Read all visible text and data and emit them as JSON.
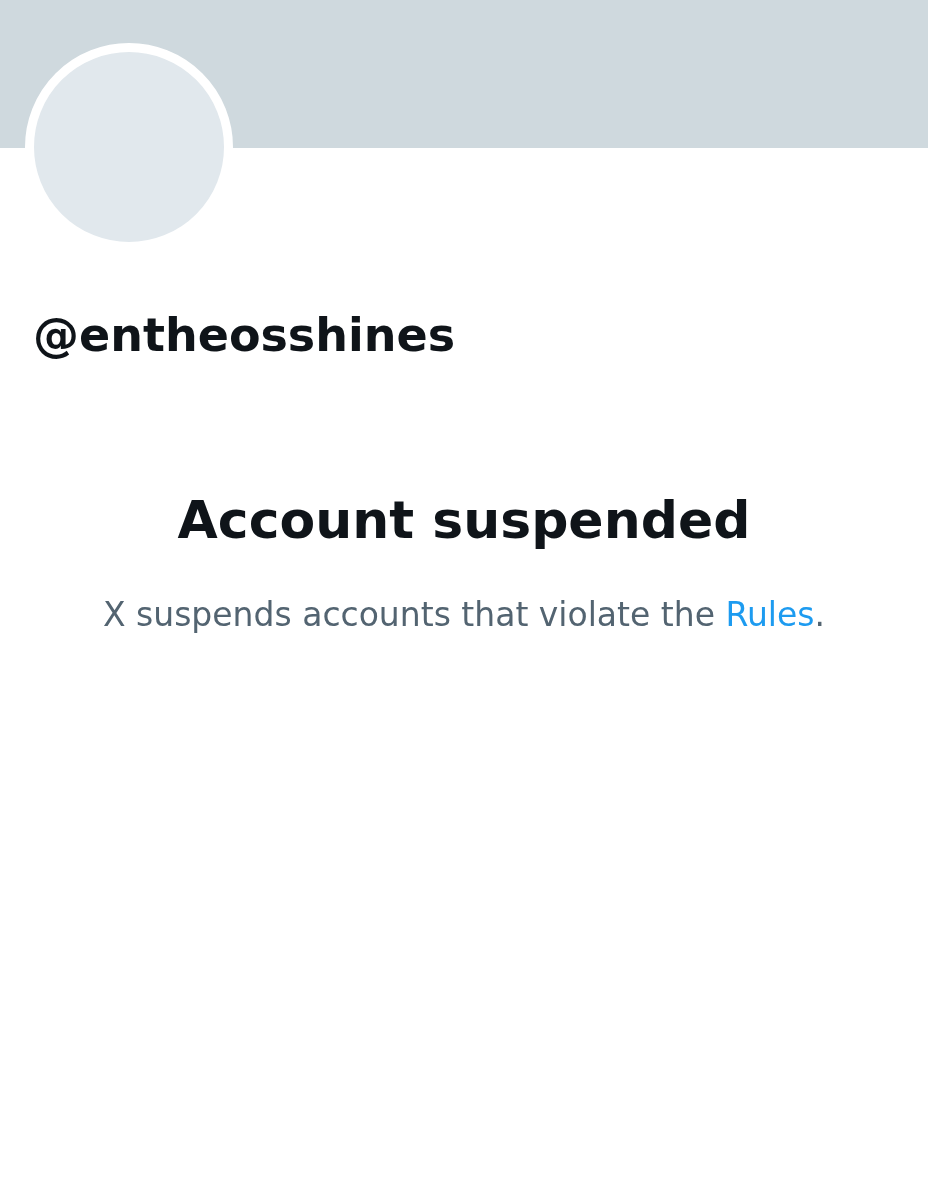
{
  "profile": {
    "handle": "@entheosshines"
  },
  "notice": {
    "title": "Account suspended",
    "text_before": "X suspends accounts that violate the",
    "link": "Rules",
    "text_after": "."
  }
}
